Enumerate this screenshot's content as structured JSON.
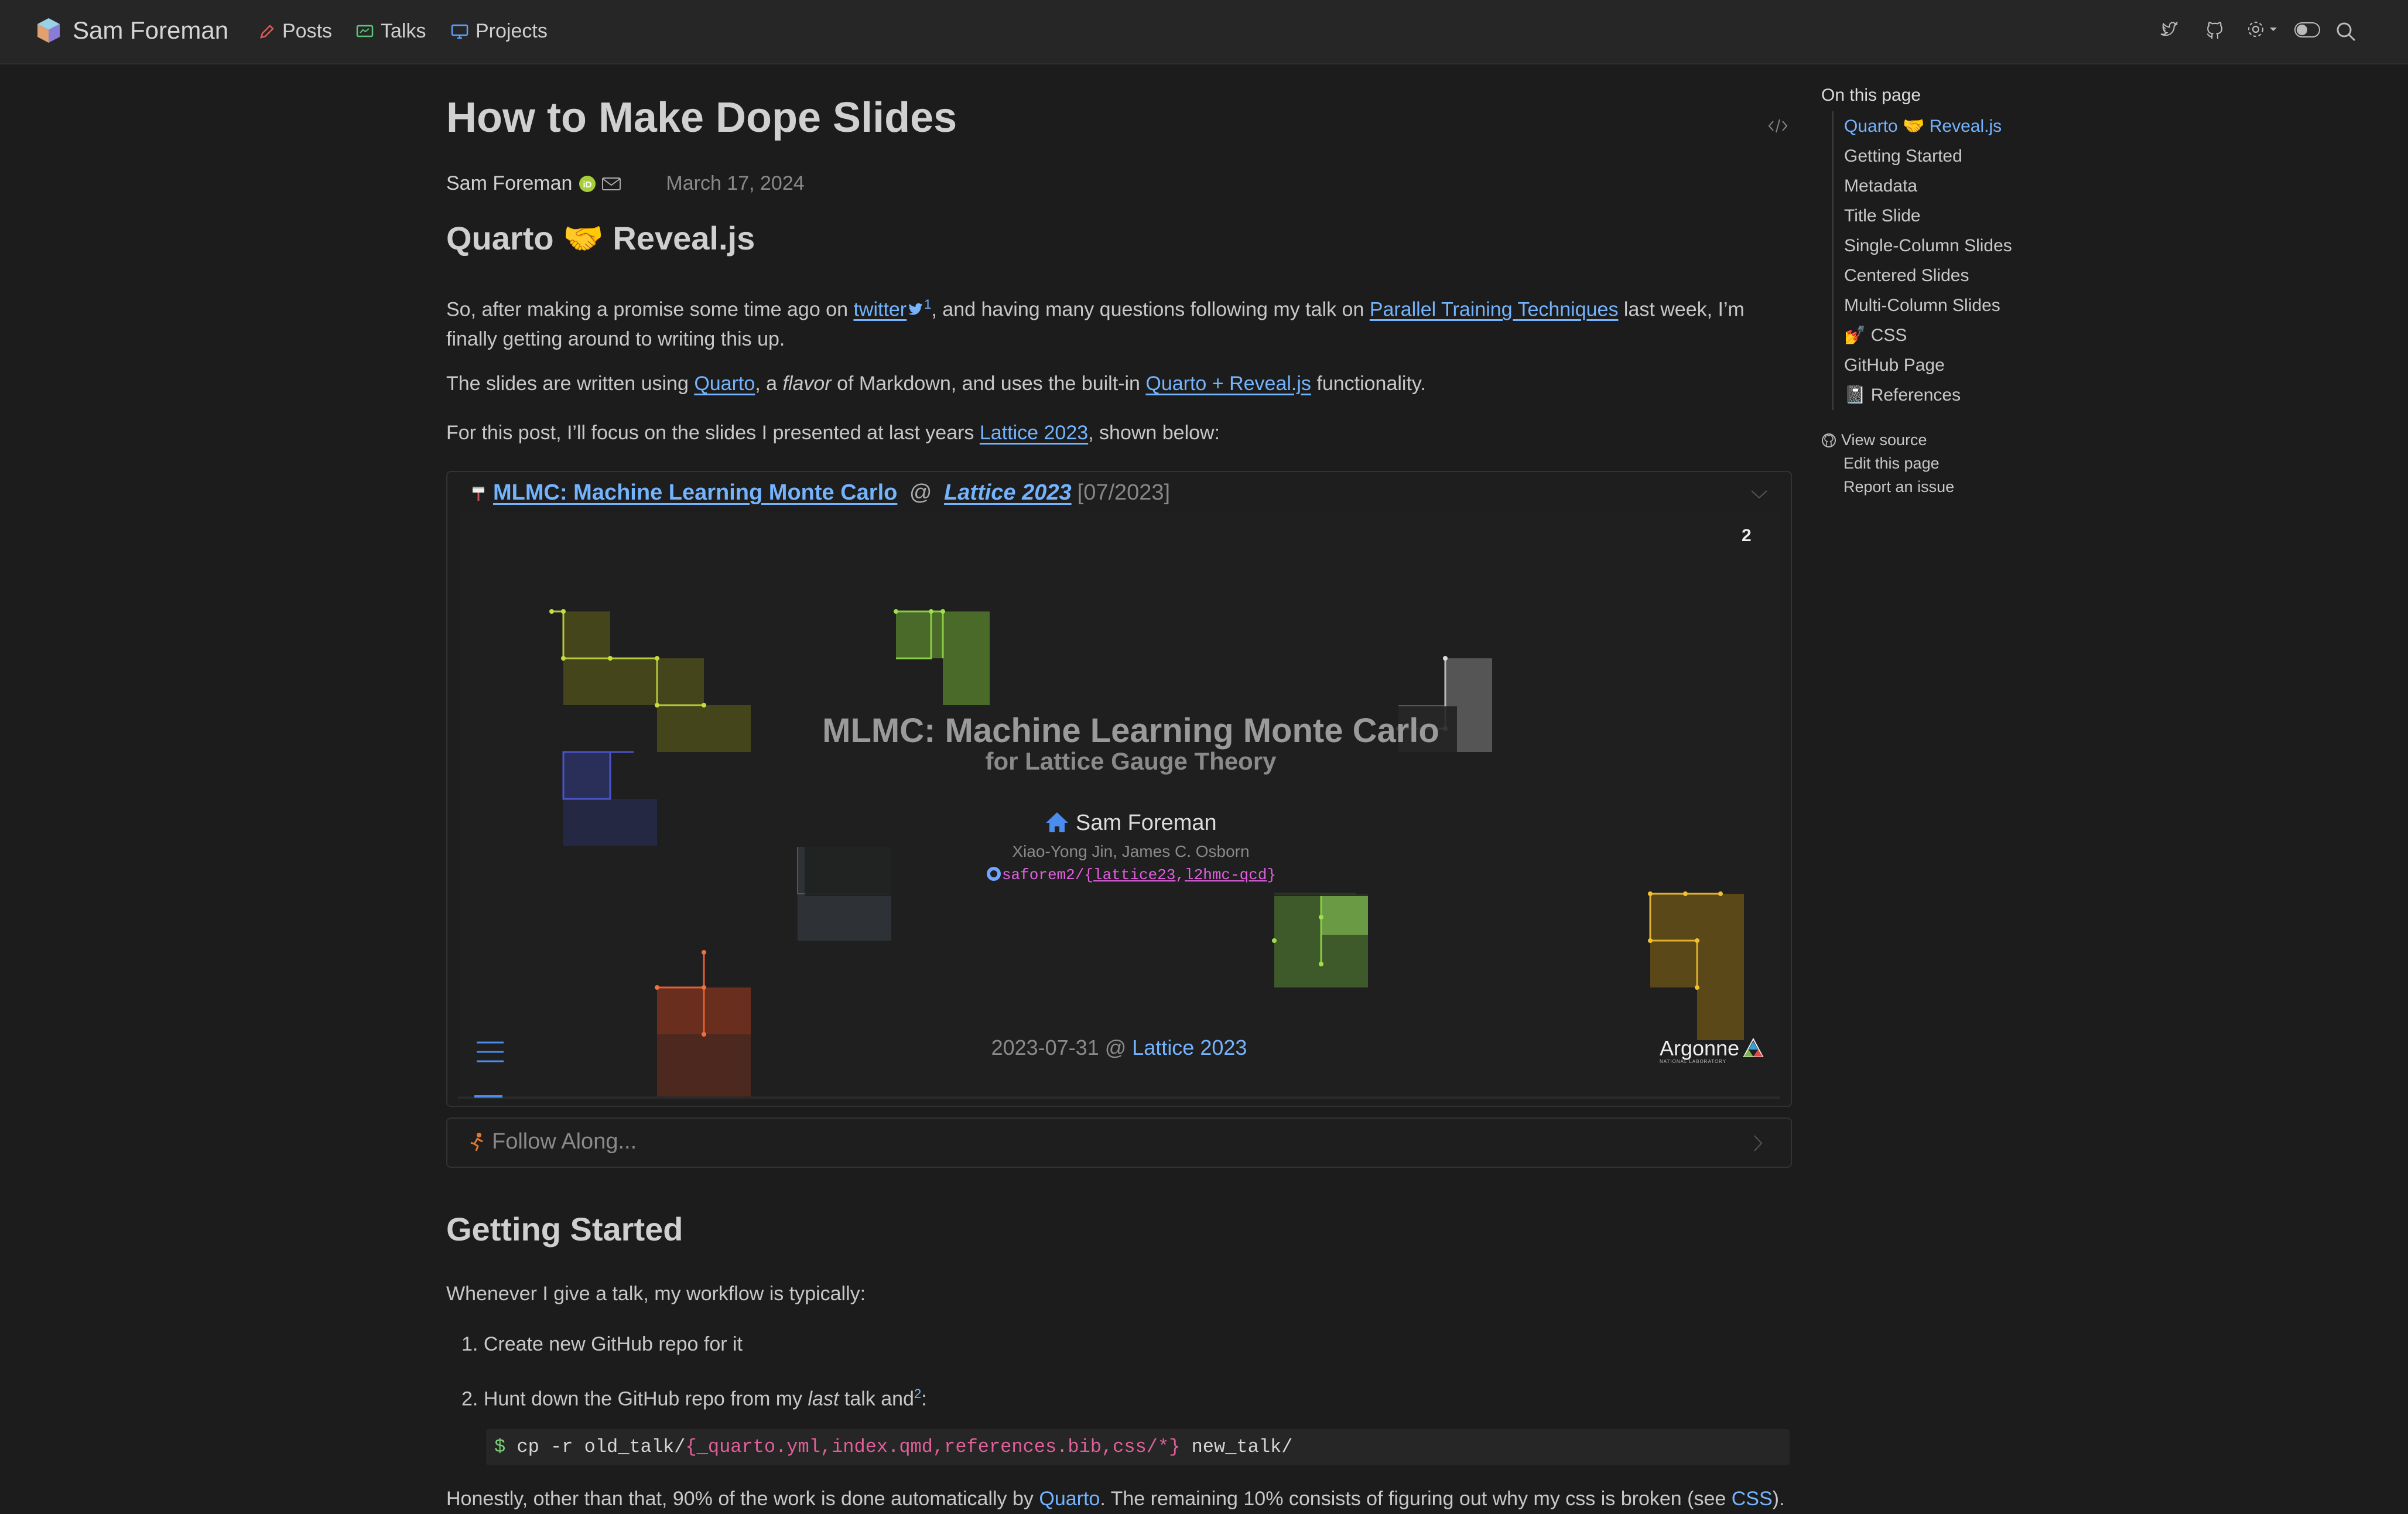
{
  "navbar": {
    "brand": "Sam Foreman",
    "links": [
      {
        "label": "Posts",
        "icon": "pencil-icon"
      },
      {
        "label": "Talks",
        "icon": "presentation-icon"
      },
      {
        "label": "Projects",
        "icon": "monitor-icon"
      }
    ],
    "right_icons": [
      "twitter-icon",
      "github-icon",
      "gear-icon",
      "toggle-icon",
      "search-icon"
    ]
  },
  "post": {
    "title": "How to Make Dope Slides",
    "author": "Sam Foreman",
    "date": "March 17, 2024",
    "section1_heading": "Quarto 🤝 Reveal.js",
    "p1_a": "So, after making a promise some time ago on ",
    "p1_twitter": "twitter",
    "p1_sup": "1",
    "p1_b": ", and having many questions following my talk on ",
    "p1_link": "Parallel Training Techniques",
    "p1_c": " last week, I’m finally getting around to writing this up.",
    "p2_a": "The slides are written using ",
    "p2_quarto": "Quarto",
    "p2_b": ", a ",
    "p2_flavor": "flavor",
    "p2_c": " of Markdown, and uses the built-in ",
    "p2_link": "Quarto + Reveal.js",
    "p2_d": " functionality.",
    "p3_a": "For this post, I’ll focus on the slides I presented at last years ",
    "p3_link": "Lattice 2023",
    "p3_b": ", shown below:"
  },
  "callout": {
    "title_link": "MLMC: Machine Learning Monte Carlo",
    "at": " @ ",
    "venue": "Lattice 2023",
    "date": "[07/2023]",
    "slide": {
      "page_number": "2",
      "title": "MLMC: Machine Learning Monte Carlo",
      "subtitle": "for Lattice Gauge Theory",
      "presenter": "Sam Foreman",
      "coauthors": "Xiao-Yong Jin, James C. Osborn",
      "repo_prefix": "saforem2/{",
      "repo_a": "lattice23",
      "repo_sep": ",",
      "repo_b": "l2hmc-qcd",
      "repo_suffix": "}",
      "footer_date": "2023-07-31 @ ",
      "footer_venue": "Lattice 2023",
      "logo_text": "Argonne",
      "logo_sub": "NATIONAL LABORATORY"
    }
  },
  "follow": {
    "label": "Follow Along..."
  },
  "getting_started": {
    "heading": "Getting Started",
    "intro": "Whenever I give a talk, my workflow is typically:",
    "item1": "Create new GitHub repo for it",
    "item2_a": "Hunt down the GitHub repo from my ",
    "item2_em": "last",
    "item2_b": " talk and",
    "item2_sup": "2",
    "item2_c": ":",
    "code_prompt": "$",
    "code_cmd": " cp -r old_talk/",
    "code_glob": "{_quarto.yml,index.qmd,references.bib,css/*}",
    "code_dest": " new_talk/",
    "last_a": "Honestly, other than that, 90% of the work is done automatically by ",
    "last_quarto": "Quarto",
    "last_b": ". The remaining 10% consists of figuring out why my css is broken (see ",
    "last_css": "CSS",
    "last_c": ")."
  },
  "toc": {
    "title": "On this page",
    "items": [
      "Quarto 🤝 Reveal.js",
      "Getting Started",
      "Metadata",
      "Title Slide",
      "Single-Column Slides",
      "Centered Slides",
      "Multi-Column Slides",
      "💅 CSS",
      "GitHub Page",
      "📓 References"
    ],
    "view_source": "View source",
    "edit": "Edit this page",
    "report": "Report an issue"
  },
  "colors": {
    "accent": "#74b4ff",
    "background": "#1c1c1c",
    "navbar": "#262626"
  }
}
